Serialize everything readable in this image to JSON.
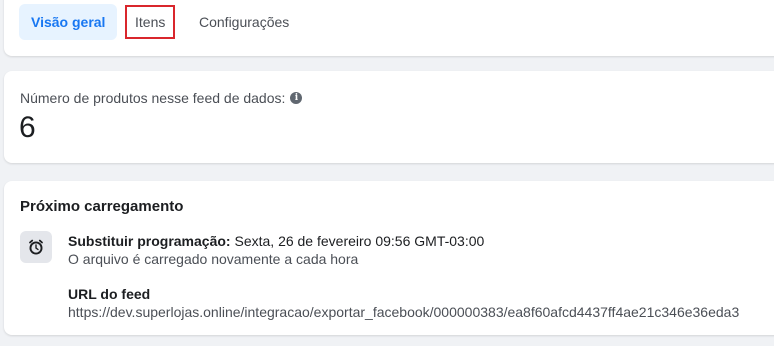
{
  "tabs": [
    {
      "label": "Visão geral",
      "active": true
    },
    {
      "label": "Itens",
      "highlighted": true
    },
    {
      "label": "Configurações"
    }
  ],
  "product_count": {
    "label": "Número de produtos nesse feed de dados:",
    "value": "6",
    "info_icon": "info-icon"
  },
  "next_upload": {
    "title": "Próximo carregamento",
    "icon": "clock-icon",
    "schedule_label": "Substituir programação:",
    "schedule_value": "Sexta, 26 de fevereiro 09:56 GMT-03:00",
    "frequency_text": "O arquivo é carregado novamente a cada hora",
    "feed_url_label": "URL do feed",
    "feed_url": "https://dev.superlojas.online/integracao/exportar_facebook/000000383/ea8f60afcd4437ff4ae21c346e36eda3"
  },
  "colors": {
    "accent": "#1877f2",
    "active_tab_bg": "#e7f3ff",
    "highlight_border": "#d9262c",
    "page_bg": "#f0f2f5"
  }
}
